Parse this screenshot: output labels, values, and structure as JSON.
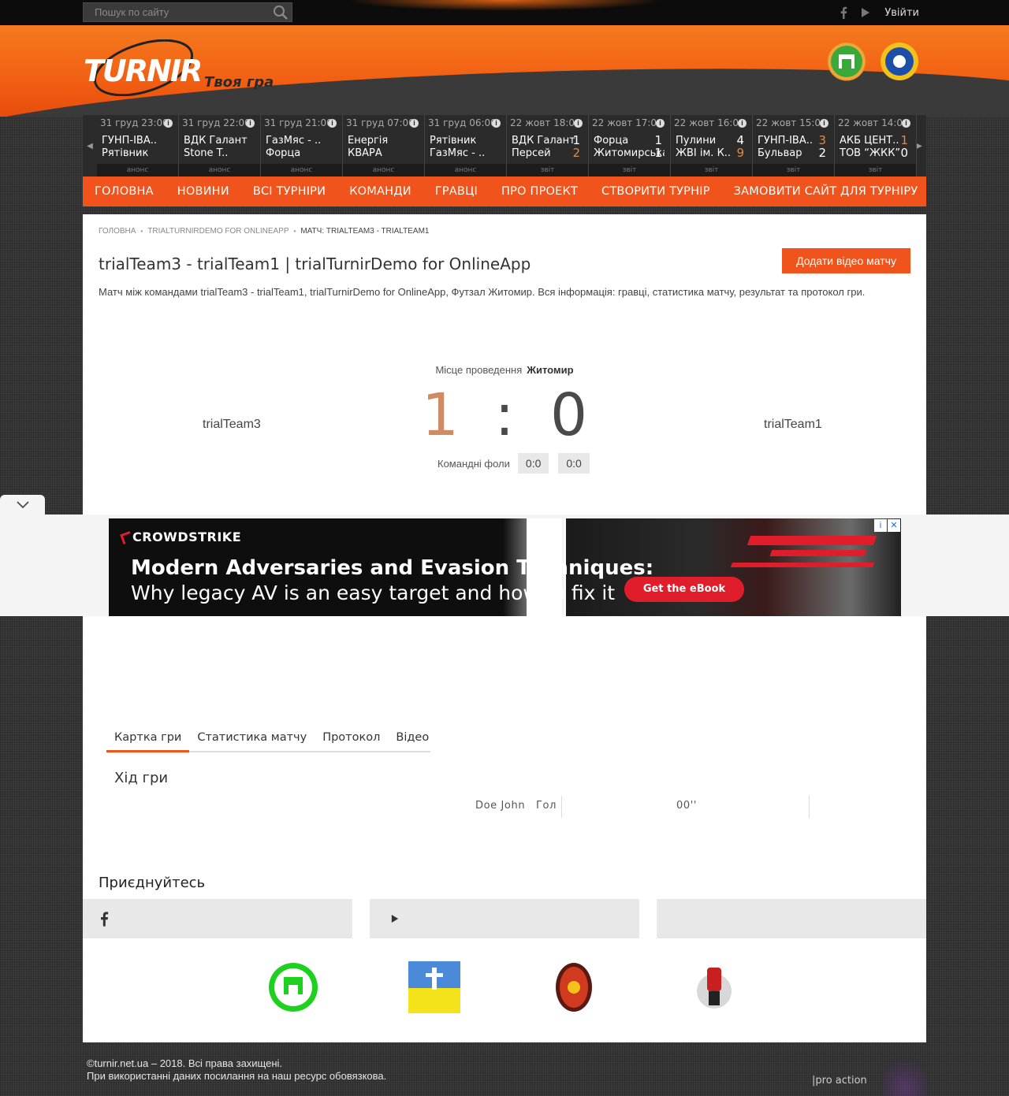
{
  "topbar": {
    "search_placeholder": "Пошук по сайту",
    "login": "Увійти",
    "icons": [
      "facebook-icon",
      "youtube-icon"
    ]
  },
  "header": {
    "logo": "TURNIR",
    "slogan": "Твоя гра"
  },
  "ticker": [
    {
      "date": "31 груд 23:00",
      "home": "ГУНП-ІВА..",
      "away": "Рятівник",
      "hs": "",
      "as": "",
      "status": "анонс"
    },
    {
      "date": "31 груд 22:00",
      "home": "ВДК Галант",
      "away": "Stone T..",
      "hs": "",
      "as": "",
      "status": "анонс"
    },
    {
      "date": "31 груд 21:00",
      "home": "ГазМяс - ..",
      "away": "Форца",
      "hs": "",
      "as": "",
      "status": "анонс"
    },
    {
      "date": "31 груд 07:00",
      "home": "Енергія",
      "away": "КВАРА",
      "hs": "",
      "as": "",
      "status": "анонс"
    },
    {
      "date": "31 груд 06:00",
      "home": "Рятівник",
      "away": "ГазМяс - ..",
      "hs": "",
      "as": "",
      "status": "анонс"
    },
    {
      "date": "22 жовт 18:00",
      "home": "ВДК Галант",
      "away": "Персей",
      "hs": "1",
      "as": "2",
      "status": "звіт",
      "hl": "away"
    },
    {
      "date": "22 жовт 17:00",
      "home": "Форца",
      "away": "Житомирська..",
      "hs": "1",
      "as": "1",
      "status": "звіт",
      "hl": ""
    },
    {
      "date": "22 жовт 16:00",
      "home": "Пулини",
      "away": "ЖВІ ім. К..",
      "hs": "4",
      "as": "9",
      "status": "звіт",
      "hl": "away"
    },
    {
      "date": "22 жовт 15:00",
      "home": "ГУНП-ІВА..",
      "away": "Бульвар",
      "hs": "3",
      "as": "2",
      "status": "звіт",
      "hl": "home"
    },
    {
      "date": "22 жовт 14:00",
      "home": "АКБ ЦЕНТ..",
      "away": "ТОВ “ЖКК”",
      "hs": "1",
      "as": "0",
      "status": "звіт",
      "hl": "home"
    }
  ],
  "nav": [
    "Головна",
    "Новини",
    "Всі турніри",
    "Команди",
    "Гравці",
    "Про проект",
    "Створити турнір",
    "Замовити сайт для турніру"
  ],
  "breadcrumb": [
    "Головна",
    "trialTurnirDemo for OnlineApp",
    "Матч: trialTeam3 - trialTeam1"
  ],
  "page": {
    "title": "trialTeam3 - trialTeam1 | trialTurnirDemo for OnlineApp",
    "add_video": "Додати відео матчу",
    "description": "Матч між командами trialTeam3 - trialTeam1, trialTurnirDemo for OnlineApp, Футзал Житомир. Вся інформація: гравці, статистика матчу, результат та протокол гри."
  },
  "match": {
    "venue_label": "Місце проведення",
    "venue": "Житомир",
    "home": "trialTeam3",
    "away": "trialTeam1",
    "home_score": "1",
    "away_score": "0",
    "separator": ":",
    "fouls_label": "Командні фоли",
    "home_fouls": "0:0",
    "away_fouls": "0:0"
  },
  "ad": {
    "brand": "CROWDSTRIKE",
    "headline": "Modern Adversaries and Evasion Techniques:",
    "subline": "Why legacy AV is an easy target and how to fix it",
    "cta": "Get the eBook",
    "info": "i",
    "close": "✕"
  },
  "tabs": [
    "Картка гри",
    "Статистика матчу",
    "Протокол",
    "Відео"
  ],
  "game": {
    "heading": "Хід гри",
    "events": [
      {
        "player": "Doe John",
        "type": "Гол",
        "time": "00''"
      }
    ]
  },
  "join": {
    "heading": "Приєднуйтесь"
  },
  "footer": {
    "line1": "©turnir.net.ua – 2018. Всі права захищені.",
    "line2": "При використанні даних посилання на наш ресурс обовязкова.",
    "credit": "|pro action"
  },
  "colors": {
    "accent": "#f0531c",
    "score_home": "#d08b64"
  }
}
